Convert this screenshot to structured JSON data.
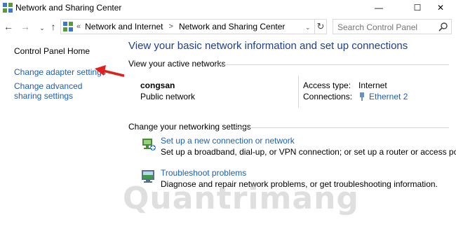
{
  "window": {
    "title": "Network and Sharing Center",
    "controls": {
      "minimize": "—",
      "maximize": "☐",
      "close": "✕"
    }
  },
  "address_bar": {
    "nav": {
      "back": "←",
      "forward": "→",
      "history": "⌄",
      "up": "↑"
    },
    "overflow": "«",
    "breadcrumbs": [
      "Network and Internet",
      "Network and Sharing Center"
    ],
    "separator": ">",
    "dropdown": "⌄",
    "refresh": "↻"
  },
  "search": {
    "placeholder": "Search Control Panel"
  },
  "left_nav": {
    "home": "Control Panel Home",
    "links": [
      "Change adapter settings",
      "Change advanced sharing settings"
    ]
  },
  "main": {
    "heading": "View your basic network information and set up connections",
    "active_networks_label": "View your active networks",
    "network": {
      "name": "congsan",
      "type": "Public network",
      "access_type_label": "Access type:",
      "access_type_value": "Internet",
      "connections_label": "Connections:",
      "connections_value": "Ethernet 2"
    },
    "settings_label": "Change your networking settings",
    "tasks": [
      {
        "icon": "network-setup-icon",
        "link": "Set up a new connection or network",
        "desc": "Set up a broadband, dial-up, or VPN connection; or set up a router or access point."
      },
      {
        "icon": "troubleshoot-icon",
        "link": "Troubleshoot problems",
        "desc": "Diagnose and repair network problems, or get troubleshooting information."
      }
    ]
  },
  "watermark": "Quantrimang",
  "colors": {
    "link": "#1a5fb4",
    "heading": "#1e3f8f",
    "annotation_arrow": "#e0201c"
  }
}
